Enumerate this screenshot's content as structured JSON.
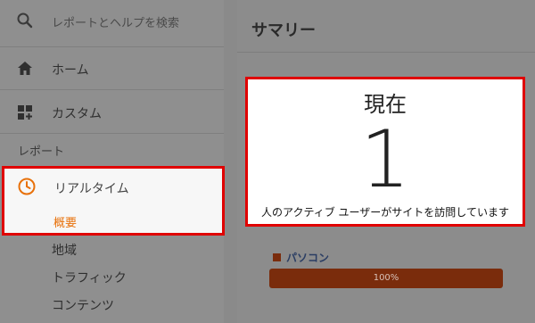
{
  "sidebar": {
    "search_placeholder": "レポートとヘルプを検索",
    "home_label": "ホーム",
    "custom_label": "カスタム",
    "reports_section": "レポート",
    "realtime_label": "リアルタイム",
    "overview_label": "概要",
    "sub_items": [
      "地域",
      "トラフィック",
      "コンテンツ"
    ]
  },
  "main": {
    "title": "サマリー",
    "current": {
      "heading": "現在",
      "value": "1",
      "caption": "人のアクティブ ユーザーがサイトを訪問しています"
    },
    "device": {
      "label": "パソコン",
      "percent_text": "100%",
      "fraction": 1.0
    }
  },
  "colors": {
    "accent_orange": "#e8710a",
    "highlight_red": "#e00000",
    "bar_brown": "#7a2c0c"
  },
  "icons": {
    "search": "search-icon",
    "home": "home-icon",
    "custom": "dashboard-add-icon",
    "realtime": "clock-icon"
  }
}
